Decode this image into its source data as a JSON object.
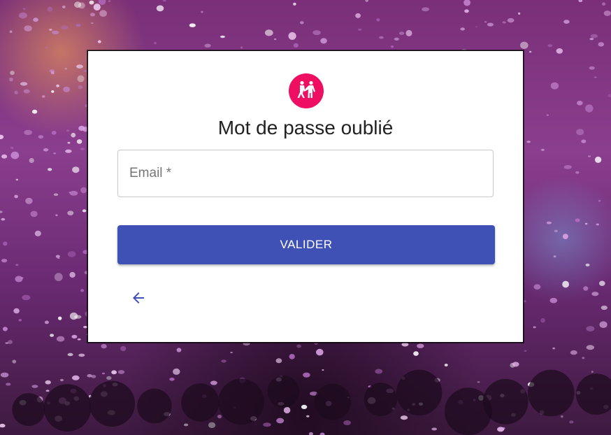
{
  "page": {
    "title": "Mot de passe oublié"
  },
  "form": {
    "email_placeholder": "Email *",
    "email_value": "",
    "submit_label": "VALIDER"
  },
  "icons": {
    "avatar": "people-fighting-icon",
    "back": "arrow-left-icon"
  },
  "colors": {
    "accent": "#3f51b5",
    "avatar_bg": "#ef0f62"
  }
}
